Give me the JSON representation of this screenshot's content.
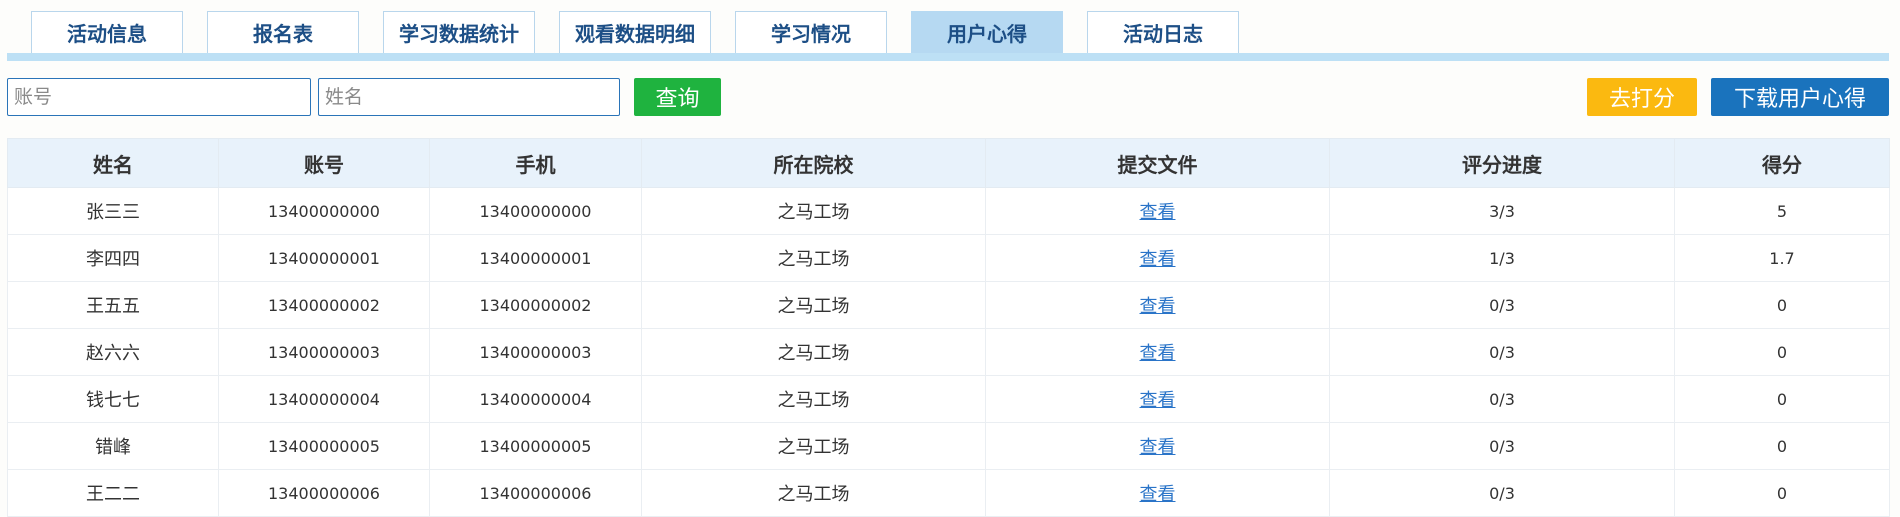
{
  "tabs": [
    {
      "label": "活动信息",
      "active": false
    },
    {
      "label": "报名表",
      "active": false
    },
    {
      "label": "学习数据统计",
      "active": false
    },
    {
      "label": "观看数据明细",
      "active": false
    },
    {
      "label": "学习情况",
      "active": false
    },
    {
      "label": "用户心得",
      "active": true
    },
    {
      "label": "活动日志",
      "active": false
    }
  ],
  "search": {
    "account_placeholder": "账号",
    "name_placeholder": "姓名",
    "query_label": "查询"
  },
  "actions": {
    "score_label": "去打分",
    "download_label": "下载用户心得"
  },
  "colors": {
    "accent": "#1a73bd",
    "tab_active": "#b6d9f2",
    "query": "#1fb33f",
    "score": "#fbb910",
    "link": "#2a74c8"
  },
  "table": {
    "headers": [
      "姓名",
      "账号",
      "手机",
      "所在院校",
      "提交文件",
      "评分进度",
      "得分"
    ],
    "rows": [
      {
        "name": "张三三",
        "account": "13400000000",
        "phone": "13400000000",
        "school": "之马工场",
        "file": "查看",
        "progress": "3/3",
        "score": "5"
      },
      {
        "name": "李四四",
        "account": "13400000001",
        "phone": "13400000001",
        "school": "之马工场",
        "file": "查看",
        "progress": "1/3",
        "score": "1.7"
      },
      {
        "name": "王五五",
        "account": "13400000002",
        "phone": "13400000002",
        "school": "之马工场",
        "file": "查看",
        "progress": "0/3",
        "score": "0"
      },
      {
        "name": "赵六六",
        "account": "13400000003",
        "phone": "13400000003",
        "school": "之马工场",
        "file": "查看",
        "progress": "0/3",
        "score": "0"
      },
      {
        "name": "钱七七",
        "account": "13400000004",
        "phone": "13400000004",
        "school": "之马工场",
        "file": "查看",
        "progress": "0/3",
        "score": "0"
      },
      {
        "name": "错峰",
        "account": "13400000005",
        "phone": "13400000005",
        "school": "之马工场",
        "file": "查看",
        "progress": "0/3",
        "score": "0"
      },
      {
        "name": "王二二",
        "account": "13400000006",
        "phone": "13400000006",
        "school": "之马工场",
        "file": "查看",
        "progress": "0/3",
        "score": "0"
      }
    ]
  }
}
